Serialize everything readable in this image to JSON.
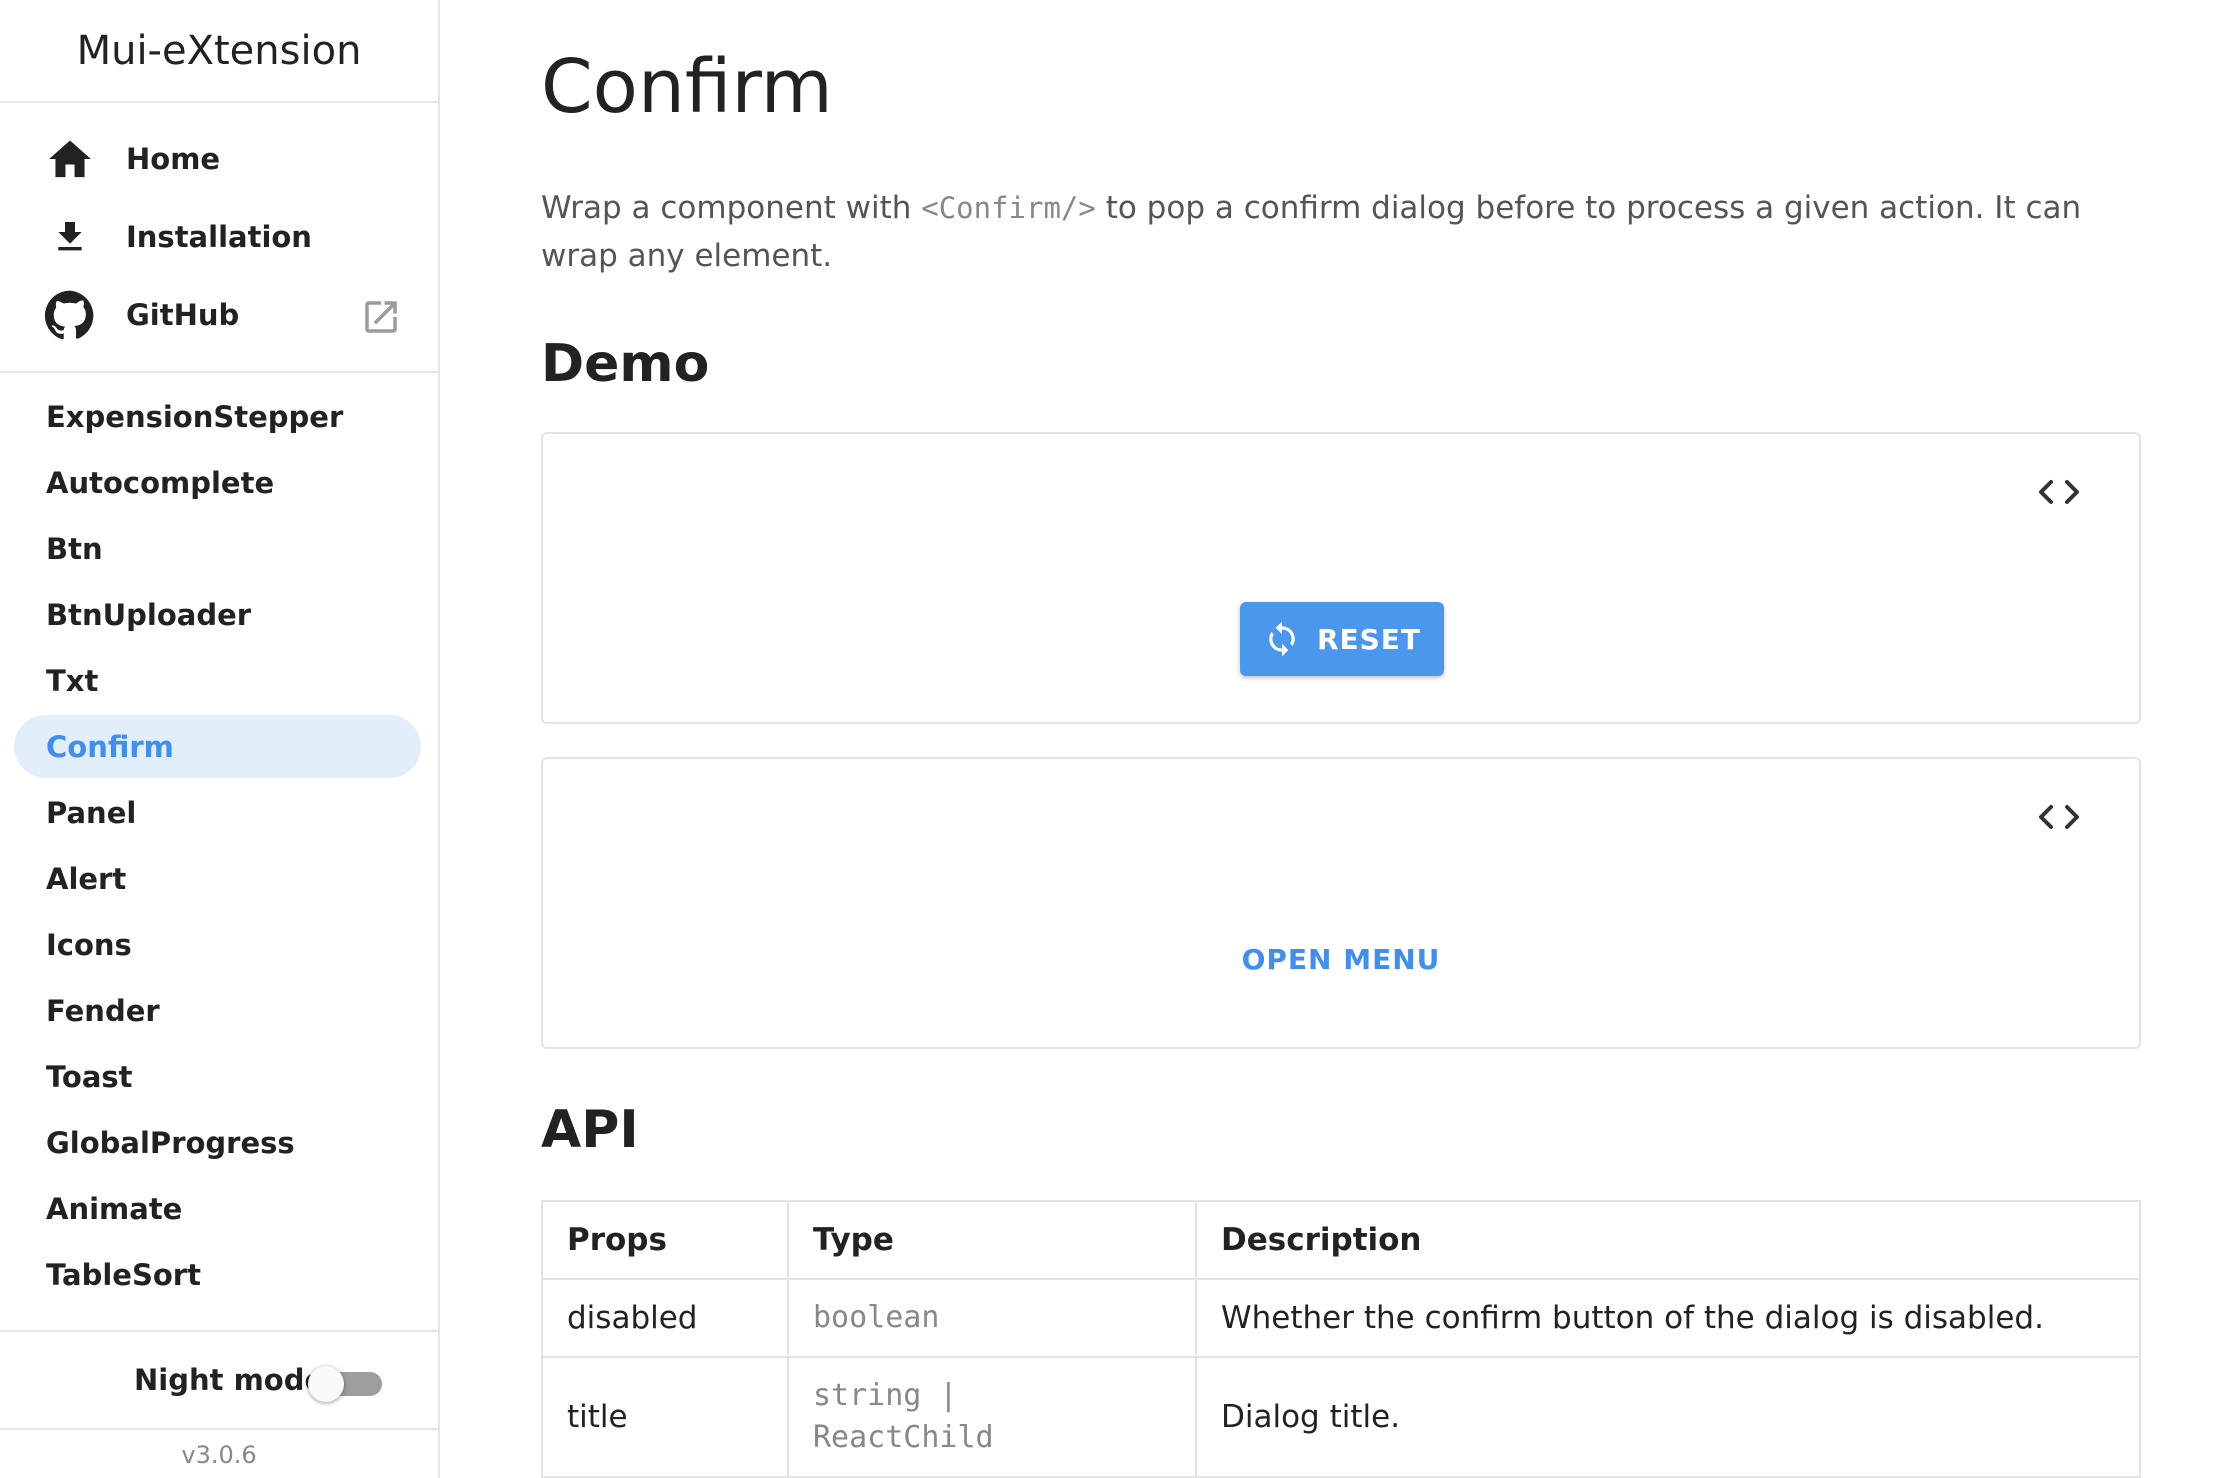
{
  "sidebar": {
    "brand": "Mui-eXtension",
    "top_items": [
      {
        "label": "Home",
        "icon": "home-icon"
      },
      {
        "label": "Installation",
        "icon": "download-icon"
      },
      {
        "label": "GitHub",
        "icon": "github-icon",
        "external_icon": "open-in-new-icon"
      }
    ],
    "components": [
      "ExpensionStepper",
      "Autocomplete",
      "Btn",
      "BtnUploader",
      "Txt",
      "Confirm",
      "Panel",
      "Alert",
      "Icons",
      "Fender",
      "Toast",
      "GlobalProgress",
      "Animate",
      "TableSort"
    ],
    "active_component": "Confirm",
    "night_mode": {
      "label": "Night mode",
      "icon": "moon-icon",
      "enabled": false
    },
    "version": "v3.0.6"
  },
  "main": {
    "title": "Confirm",
    "intro": {
      "before": "Wrap a component with ",
      "code": "<Confirm/>",
      "after": " to pop a confirm dialog before to process a given action. It can wrap any element."
    },
    "demo_heading": "Demo",
    "demos": [
      {
        "button_label": "RESET",
        "button_icon": "sync-icon",
        "code_toggle_icon": "code-icon"
      },
      {
        "button_label": "OPEN MENU",
        "code_toggle_icon": "code-icon"
      }
    ],
    "api_heading": "API",
    "api_table": {
      "headers": [
        "Props",
        "Type",
        "Description"
      ],
      "rows": [
        {
          "props": "disabled",
          "type": "boolean",
          "description": "Whether the confirm button of the dialog is disabled."
        },
        {
          "props": "title",
          "type": "string | ReactChild",
          "description": "Dialog title."
        }
      ]
    }
  },
  "colors": {
    "accent": "#3f8ef0",
    "button": "#4a97ee",
    "active_bg": "#e3eefb",
    "border": "#e4e4e4"
  }
}
